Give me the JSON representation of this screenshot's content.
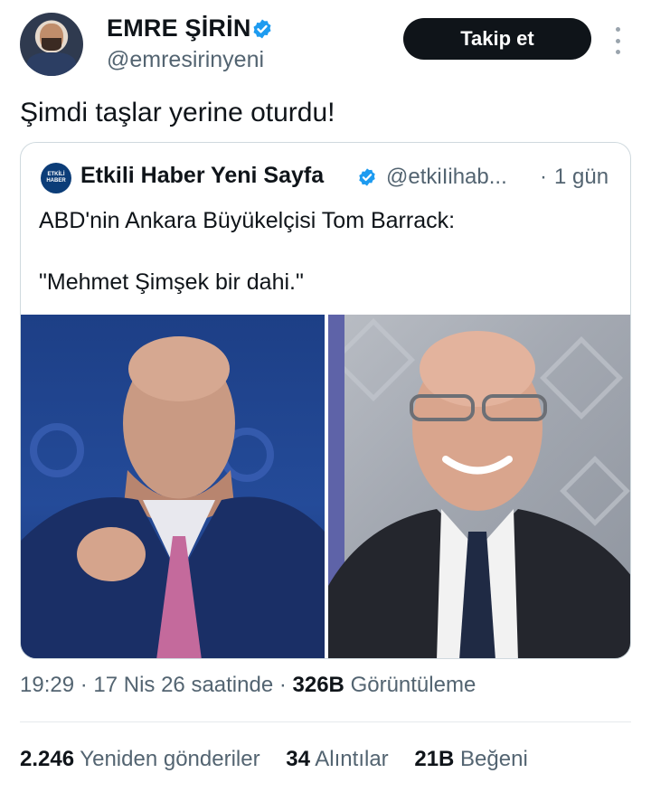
{
  "author": {
    "name": "EMRE ŞİRİN",
    "handle": "@emresirinyeni"
  },
  "follow_label": "Takip et",
  "tweet_text": "Şimdi taşlar yerine oturdu!",
  "quoted": {
    "logo_text": "ETKİLİ HABER",
    "name": "Etkili Haber Yeni Sayfa",
    "handle": "@etkiIihab...",
    "separator": "·",
    "time": "1 gün",
    "line1": "ABD'nin Ankara Büyükelçisi Tom Barrack:",
    "line2": "\"Mehmet Şimşek bir dahi.\""
  },
  "meta": {
    "time_date": "19:29 · 17 Nis 26 saatinde ·",
    "views_count": "326B",
    "views_label": "Görüntüleme"
  },
  "stats": [
    {
      "count": "2.246",
      "label": "Yeniden gönderiler"
    },
    {
      "count": "34",
      "label": "Alıntılar"
    },
    {
      "count": "21B",
      "label": "Beğeni"
    }
  ],
  "colors": {
    "verified": "#1d9bf0",
    "follow_bg": "#0f1419",
    "secondary_text": "#536471"
  },
  "icons": [
    "verified-badge-icon",
    "more-options-icon"
  ]
}
